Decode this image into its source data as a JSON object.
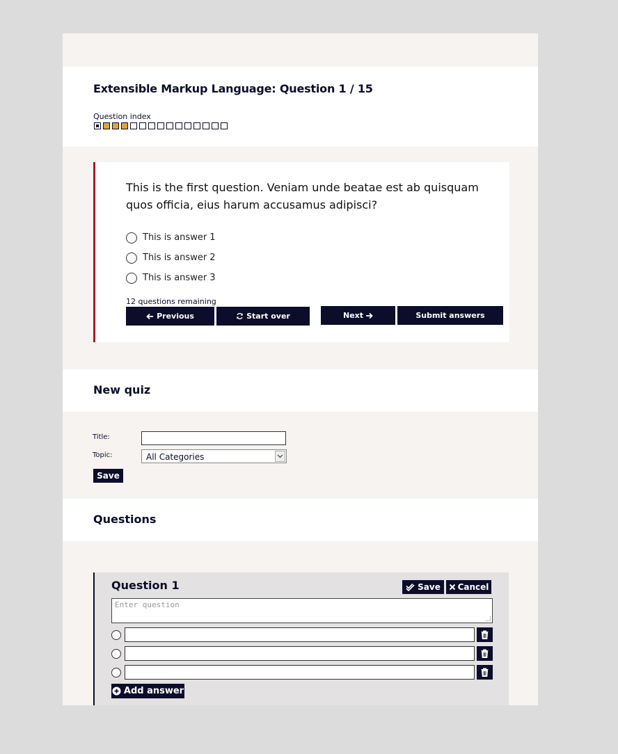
{
  "quiz": {
    "title": "Extensible Markup Language: Question 1 / 15",
    "index_label": "Question index",
    "index_states": [
      "current",
      "answered",
      "answered",
      "answered",
      "empty",
      "empty",
      "empty",
      "empty",
      "empty",
      "empty",
      "empty",
      "empty",
      "empty",
      "empty",
      "empty"
    ],
    "accent_color": "#e0a53a",
    "question_text": "This is the first question. Veniam unde beatae est ab quisquam quos officia, eius harum accusamus adipisci?",
    "answers": [
      "This is answer 1",
      "This is answer 2",
      "This is answer 3"
    ],
    "remaining": "12 questions remaining",
    "buttons": {
      "previous": "Previous",
      "start_over": "Start over",
      "next": "Next",
      "submit": "Submit answers"
    }
  },
  "new_quiz": {
    "heading": "New quiz",
    "title_label": "Title:",
    "title_value": "",
    "topic_label": "Topic:",
    "topic_value": "All Categories",
    "save_label": "Save"
  },
  "questions": {
    "heading": "Questions",
    "card_title": "Question 1",
    "save_label": "Save",
    "cancel_label": "Cancel",
    "question_placeholder": "Enter question",
    "answer_values": [
      "",
      "",
      ""
    ],
    "add_answer_label": "Add answer"
  },
  "colors": {
    "navy": "#0b0d2a",
    "crimson": "#b0172a",
    "page_bg": "#f6f3f0"
  }
}
